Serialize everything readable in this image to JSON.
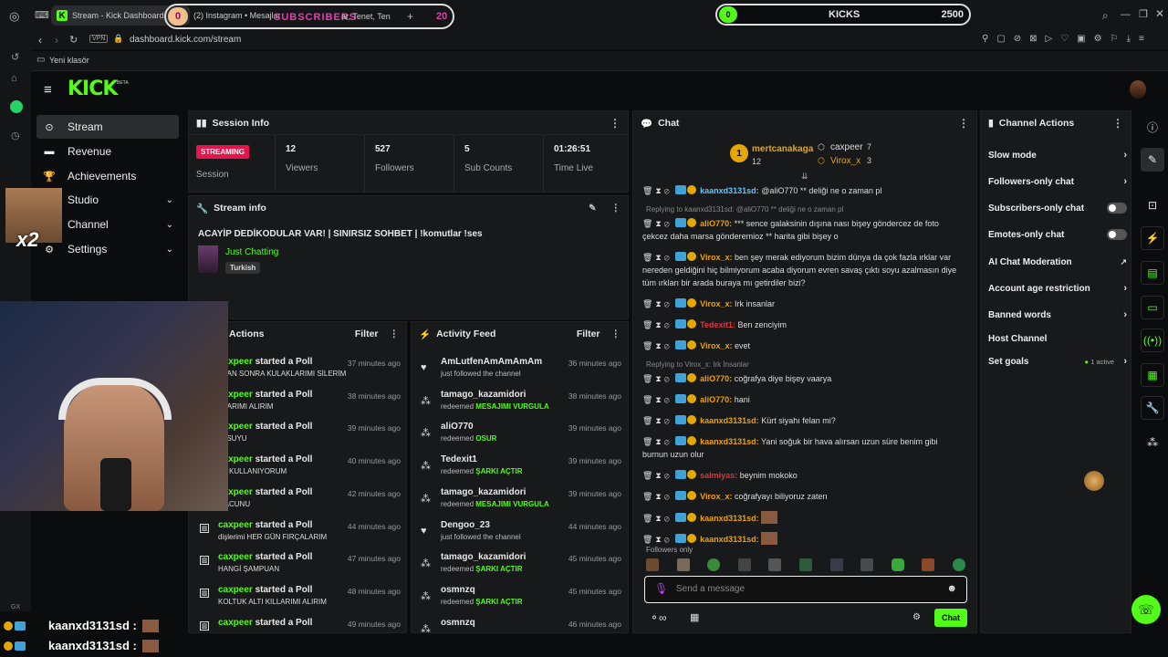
{
  "browser": {
    "tab1_title": "Stream - Kick Dashboard",
    "tab2_title": "(2) Instagram • Mesajlar",
    "tab3_title": "ar, Tenet, Ten",
    "tab_overlay_badge": "0",
    "tab_overlay_text": "SUBSCRIBERS",
    "tab_overlay_count": "20",
    "url": "dashboard.kick.com/stream",
    "vpn": "VPN",
    "bookmark": "Yeni klasör",
    "kicks_label": "KICKS",
    "kicks_left": "0",
    "kicks_right": "2500",
    "gx": "GX"
  },
  "sidebar": {
    "items": [
      {
        "label": "Stream"
      },
      {
        "label": "Revenue"
      },
      {
        "label": "Achievements"
      },
      {
        "label": "Studio"
      },
      {
        "label": "Channel"
      },
      {
        "label": "Settings"
      }
    ],
    "x2": "x2"
  },
  "session": {
    "title": "Session Info",
    "status": "STREAMING",
    "status_label": "Session",
    "viewers": "12",
    "viewers_label": "Viewers",
    "followers": "527",
    "followers_label": "Followers",
    "subs": "5",
    "subs_label": "Sub Counts",
    "time": "01:26:51",
    "time_label": "Time Live"
  },
  "stream_info": {
    "title": "Stream info",
    "stream_title": "ACAYİP DEDİKODULAR VAR! | SINIRSIZ SOHBET | !komutlar !ses",
    "category": "Just Chatting",
    "tag": "Turkish"
  },
  "actions_panel": {
    "title": "Actions",
    "filter": "Filter",
    "items": [
      {
        "user": "caxpeer",
        "action": "started a Poll",
        "sub": "ŞTAN SONRA KULAKLARIMI SİLERİM",
        "time": "37 minutes ago"
      },
      {
        "user": "caxpeer",
        "action": "started a Poll",
        "sub": "ŞLARIMI ALIRIM",
        "time": "38 minutes ago"
      },
      {
        "user": "caxpeer",
        "action": "started a Poll",
        "sub": "IZ SUYU",
        "time": "39 minutes ago"
      },
      {
        "user": "caxpeer",
        "action": "started a Poll",
        "sub": "İPİ KULLANIYORUM",
        "time": "40 minutes ago"
      },
      {
        "user": "caxpeer",
        "action": "started a Poll",
        "sub": "MACUNU",
        "time": "42 minutes ago"
      },
      {
        "user": "caxpeer",
        "action": "started a Poll",
        "sub": "dişlerimi HER GÜN FIRÇALARIM",
        "time": "44 minutes ago"
      },
      {
        "user": "caxpeer",
        "action": "started a Poll",
        "sub": "HANGİ ŞAMPUAN",
        "time": "47 minutes ago"
      },
      {
        "user": "caxpeer",
        "action": "started a Poll",
        "sub": "KOLTUK ALTI KILLARIMI ALIRIM",
        "time": "48 minutes ago"
      },
      {
        "user": "caxpeer",
        "action": "started a Poll",
        "sub": "",
        "time": "49 minutes ago"
      }
    ]
  },
  "activity": {
    "title": "Activity Feed",
    "filter": "Filter",
    "items": [
      {
        "user": "AmLutfenAmAmAmAm",
        "pre": "just followed the channel",
        "reward": "",
        "time": "36 minutes ago",
        "icon": "heart-icon"
      },
      {
        "user": "tamago_kazamidori",
        "pre": "redeemed",
        "reward": "MESAJIMI VURGULA",
        "time": "38 minutes ago",
        "icon": "reward-icon"
      },
      {
        "user": "aliO770",
        "pre": "redeemed",
        "reward": "OSUR",
        "time": "39 minutes ago",
        "icon": "reward-icon"
      },
      {
        "user": "Tedexit1",
        "pre": "redeemed",
        "reward": "ŞARKI AÇTIR",
        "time": "39 minutes ago",
        "icon": "reward-icon"
      },
      {
        "user": "tamago_kazamidori",
        "pre": "redeemed",
        "reward": "MESAJIMI VURGULA",
        "time": "39 minutes ago",
        "icon": "reward-icon"
      },
      {
        "user": "Dengoo_23",
        "pre": "just followed the channel",
        "reward": "",
        "time": "44 minutes ago",
        "icon": "heart-icon"
      },
      {
        "user": "tamago_kazamidori",
        "pre": "redeemed",
        "reward": "ŞARKI AÇTIR",
        "time": "45 minutes ago",
        "icon": "reward-icon"
      },
      {
        "user": "osmnzq",
        "pre": "redeemed",
        "reward": "ŞARKI AÇTIR",
        "time": "45 minutes ago",
        "icon": "reward-icon"
      },
      {
        "user": "osmnzq",
        "pre": "",
        "reward": "",
        "time": "46 minutes ago",
        "icon": "reward-icon"
      }
    ]
  },
  "chat": {
    "title": "Chat",
    "top1_user": "mertcanakaga",
    "top1_count": "12",
    "top1_rank": "1",
    "top2_user": "caxpeer",
    "top2_count": "7",
    "top3_user": "Virox_x",
    "top3_count": "3",
    "messages": [
      {
        "reply": "",
        "user": "kaanxd3131sd:",
        "color": "#5bc8ff",
        "text": "@aliO770 ** deliği ne o zaman pl"
      },
      {
        "reply": "Replying to kaanxd3131sd: @aliO770 ** deliği ne o zaman pl",
        "user": "aliO770:",
        "color": "#f0a000",
        "text": "*** sence galaksinin dışına nası bişey göndercez de foto çekcez daha marsa gönderemioz ** harita gibi bişey o"
      },
      {
        "reply": "",
        "user": "Virox_x:",
        "color": "#f0a000",
        "text": "ben şey merak ediyorum bizim dünya da çok fazla ırklar var nereden geldiğini hiç bilmiyorum acaba diyorum evren savaş çıktı soyu azalmasın diye tüm ırkları bir arada buraya mı getirdiler bizi?"
      },
      {
        "reply": "",
        "user": "Virox_x:",
        "color": "#f0a000",
        "text": "Irk insanlar"
      },
      {
        "reply": "",
        "user": "Tedexit1:",
        "color": "#e0353a",
        "text": "Ben zenciyim"
      },
      {
        "reply": "",
        "user": "Virox_x:",
        "color": "#f0a000",
        "text": "evet"
      },
      {
        "reply": "Replying to Virox_x: Irk İnsanlar",
        "user": "aliO770:",
        "color": "#f0a000",
        "text": "coğrafya diye bişey vaarya"
      },
      {
        "reply": "",
        "user": "aliO770:",
        "color": "#f0a000",
        "text": "hani"
      },
      {
        "reply": "",
        "user": "kaanxd3131sd:",
        "color": "#f0a000",
        "text": "Kürt siyahı felan mi?"
      },
      {
        "reply": "",
        "user": "kaanxd3131sd:",
        "color": "#f0a000",
        "text": "Yani soğuk bir hava alırsan uzun süre benim gibi burnun uzun olur"
      },
      {
        "reply": "",
        "user": "salmiyas:",
        "color": "#e0353a",
        "text": "beynim mokoko"
      },
      {
        "reply": "",
        "user": "Virox_x:",
        "color": "#f0a000",
        "text": "coğrafyayı biliyoruz zaten"
      },
      {
        "reply": "",
        "user": "kaanxd3131sd:",
        "color": "#f0a000",
        "text": ""
      },
      {
        "reply": "",
        "user": "kaanxd3131sd:",
        "color": "#f0a000",
        "text": ""
      }
    ],
    "followers_only": "Followers only",
    "placeholder": "Send a message",
    "send": "Chat"
  },
  "channel_actions": {
    "title": "Channel Actions",
    "items": [
      {
        "label": "Slow mode",
        "control": "arrow"
      },
      {
        "label": "Followers-only chat",
        "control": "arrow"
      },
      {
        "label": "Subscribers-only chat",
        "control": "toggle"
      },
      {
        "label": "Emotes-only chat",
        "control": "toggle"
      },
      {
        "label": "AI Chat Moderation",
        "control": "external"
      },
      {
        "label": "Account age restriction",
        "control": "arrow"
      },
      {
        "label": "Banned words",
        "control": "arrow"
      },
      {
        "label": "Host Channel",
        "control": "none"
      },
      {
        "label": "Set goals",
        "control": "arrow"
      }
    ],
    "goals_active": "1 active"
  },
  "overlay_bottom": [
    {
      "user": "kaanxd3131sd :"
    },
    {
      "user": "kaanxd3131sd :"
    }
  ],
  "colors": {
    "accent": "#53fc18",
    "streaming": "#e8124d",
    "panel": "#18191b"
  }
}
